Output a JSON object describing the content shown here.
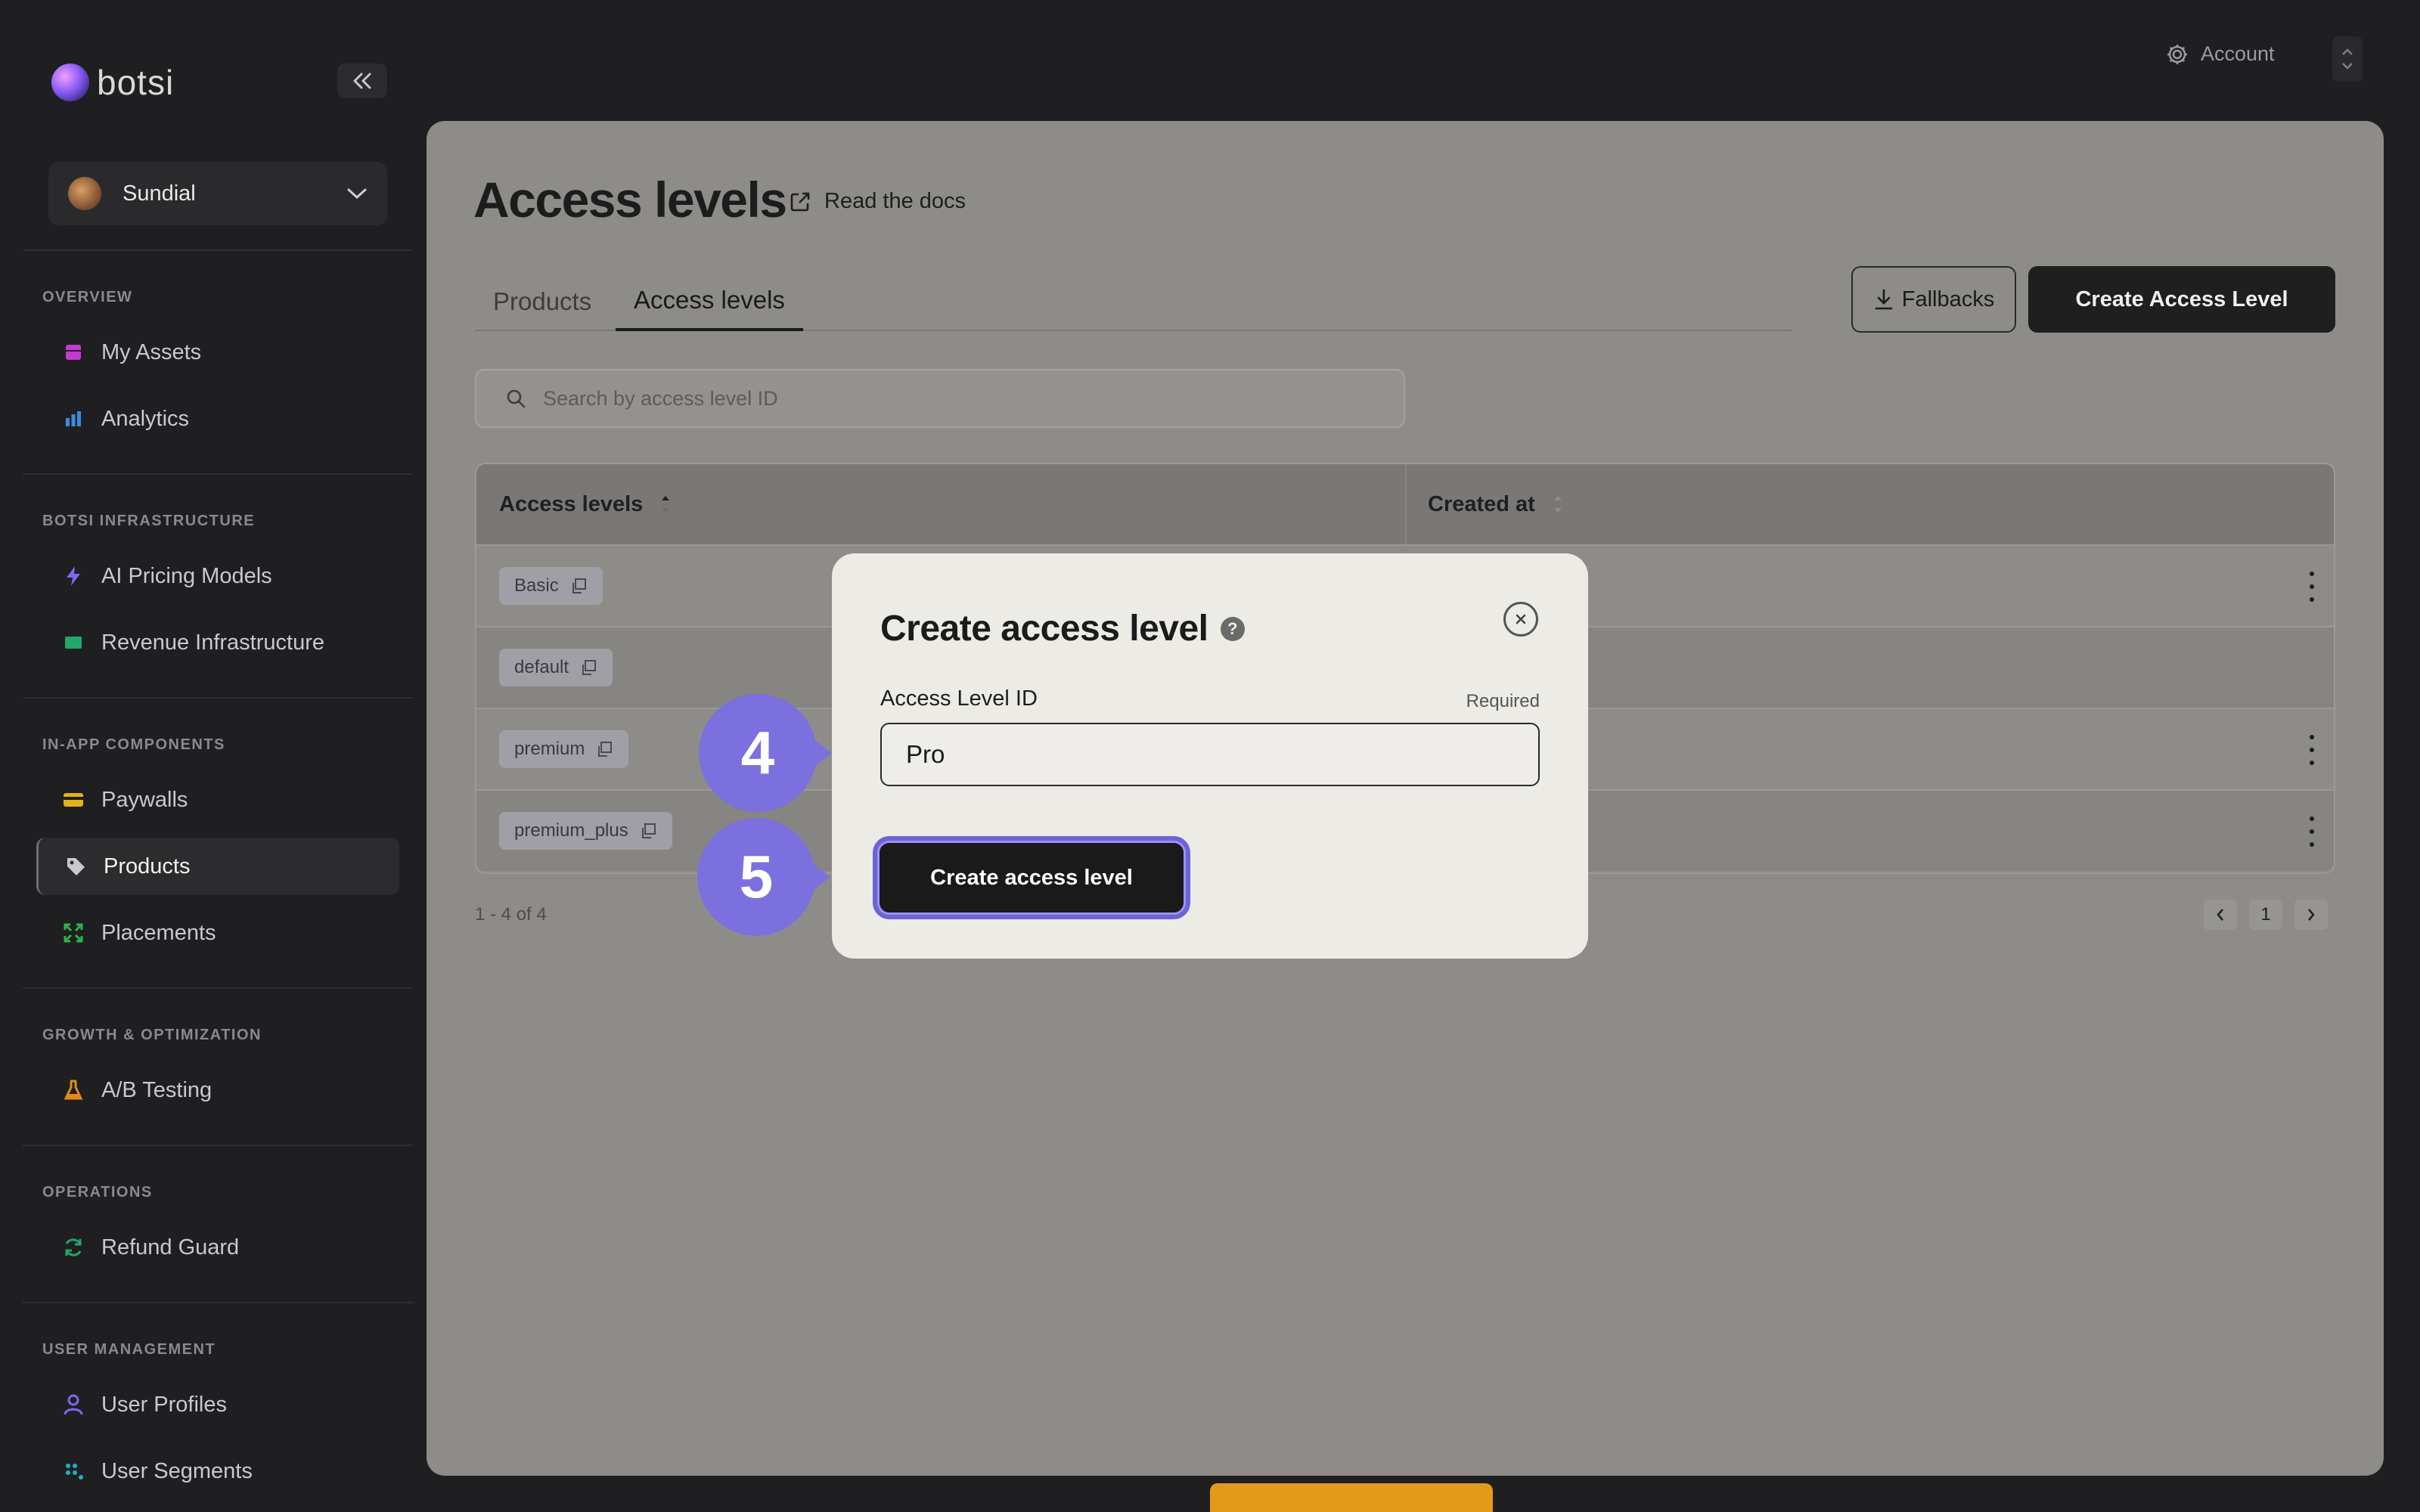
{
  "app": {
    "brand": "botsi",
    "project": "Sundial"
  },
  "sidebar": {
    "sections": [
      {
        "label": "OVERVIEW",
        "items": [
          {
            "label": "My Assets",
            "icon": "assets-icon"
          },
          {
            "label": "Analytics",
            "icon": "analytics-icon"
          }
        ]
      },
      {
        "label": "BOTSI INFRASTRUCTURE",
        "items": [
          {
            "label": "AI Pricing Models",
            "icon": "lightning-icon"
          },
          {
            "label": "Revenue Infrastructure",
            "icon": "revenue-icon"
          }
        ]
      },
      {
        "label": "IN-APP COMPONENTS",
        "items": [
          {
            "label": "Paywalls",
            "icon": "card-icon"
          },
          {
            "label": "Products",
            "icon": "tag-icon",
            "active": true
          },
          {
            "label": "Placements",
            "icon": "expand-icon"
          }
        ]
      },
      {
        "label": "GROWTH & OPTIMIZATION",
        "items": [
          {
            "label": "A/B Testing",
            "icon": "flask-icon"
          }
        ]
      },
      {
        "label": "OPERATIONS",
        "items": [
          {
            "label": "Refund Guard",
            "icon": "refresh-icon"
          }
        ]
      },
      {
        "label": "USER MANAGEMENT",
        "items": [
          {
            "label": "User Profiles",
            "icon": "user-icon"
          },
          {
            "label": "User Segments",
            "icon": "segments-icon"
          }
        ]
      }
    ]
  },
  "header": {
    "account_label": "Account"
  },
  "page": {
    "title": "Access levels",
    "docs_link": "Read the docs",
    "tabs": [
      "Products",
      "Access levels"
    ],
    "active_tab": "Access levels",
    "fallbacks_label": "Fallbacks",
    "create_label": "Create Access Level",
    "search_placeholder": "Search by access level ID"
  },
  "table": {
    "columns": [
      "Access levels",
      "Created at"
    ],
    "rows": [
      {
        "id": "Basic"
      },
      {
        "id": "default"
      },
      {
        "id": "premium"
      },
      {
        "id": "premium_plus"
      }
    ],
    "count_text": "1 - 4 of 4",
    "page": "1"
  },
  "modal": {
    "title": "Create access level",
    "help_glyph": "?",
    "field_label": "Access Level ID",
    "required_text": "Required",
    "field_value": "Pro",
    "submit_label": "Create access level"
  },
  "steps": [
    "4",
    "5"
  ],
  "colors": {
    "accent": "#7b70dd",
    "dark": "#1f1f1f",
    "modal_bg": "#ecebe6",
    "overlay_panel": "#8e8c89"
  }
}
